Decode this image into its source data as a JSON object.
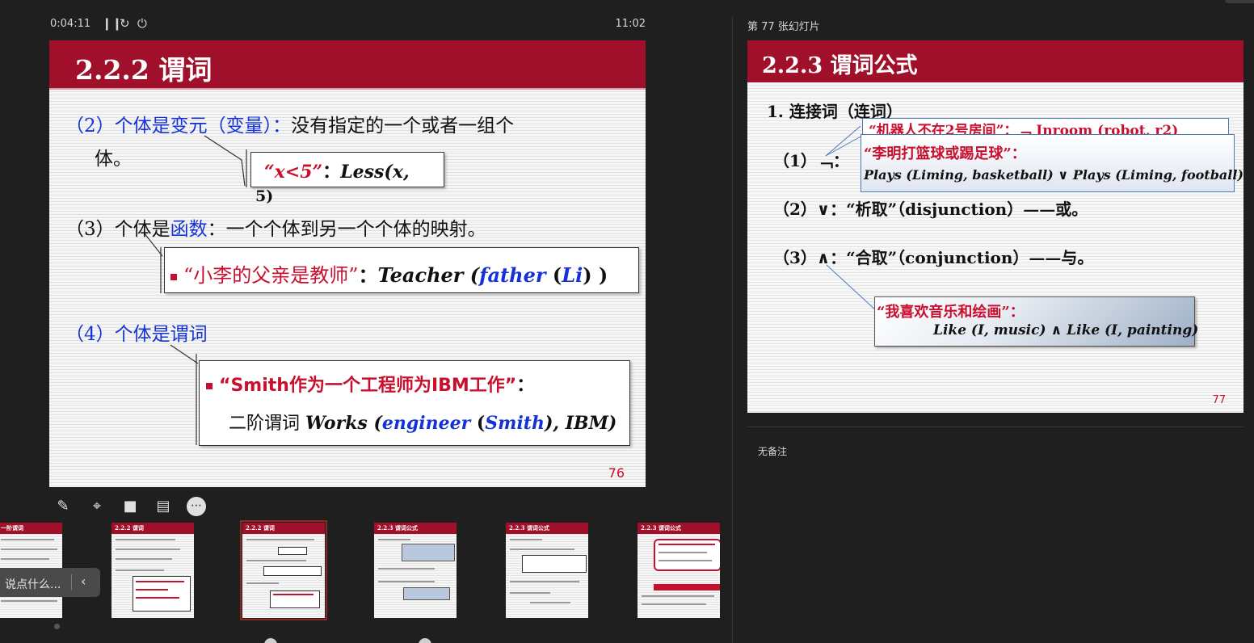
{
  "presenter": {
    "timer": "0:04:11",
    "clock": "11:02",
    "next_slide_label": "第 77 张幻灯片",
    "notes": "无备注",
    "comment_placeholder": "说点什么..."
  },
  "current_slide": {
    "number": "76",
    "title": "2.2.2 谓词",
    "item2_prefix": "（2）个体是变元（变量）：",
    "item2_text": "没有指定的一个或者一组个",
    "item2_text_cont": "体。",
    "box1_quote": "“x<5”",
    "box1_colon": "：",
    "box1_formula": "Less(x,",
    "box1_formula_cont": "5)",
    "item3_prefix": "（3）个体是",
    "item3_keyword": "函数",
    "item3_text": "：一个个体到另一个个体的映射。",
    "box2_quote": "“小李的父亲是教师”",
    "box2_colon": "：",
    "box2_formula_a": "Teacher (",
    "box2_formula_b": "father",
    "box2_formula_c": " (",
    "box2_formula_d": "Li",
    "box2_formula_e": ") )",
    "item4_prefix": "（4）个体是",
    "item4_keyword": "谓词",
    "box3_quote": "“Smith作为一个工程师为IBM工作”",
    "box3_colon": "：",
    "box3_line2_label": "二阶谓词",
    "box3_formula_a": "Works (",
    "box3_formula_b": "engineer",
    "box3_formula_c": " (",
    "box3_formula_d": "Smith",
    "box3_formula_e": "), IBM)"
  },
  "next_slide": {
    "number": "77",
    "title": "2.2.3 谓词公式",
    "heading": "1. 连接词（连词）",
    "callout1": "“机器人不在2号房间”：﹁ Inroom (robot, r2)",
    "row1_label": "（1）﹁：",
    "callout2_quote": "“李明打篮球或踢足球”：",
    "callout2_formula": "Plays (Liming, basketball) ∨ Plays (Liming, football)",
    "row2_label": "（2）∨：",
    "row2_text": "“析取”（disjunction）——或。",
    "row3_label": "（3）∧：",
    "row3_text": "“合取”（conjunction）——与。",
    "callout3_quote": "“我喜欢音乐和绘画”：",
    "callout3_formula": "Like (I, music) ∧ Like (I, painting)"
  },
  "tools": [
    {
      "name": "pen-icon",
      "glyph": "✎"
    },
    {
      "name": "zoom-icon",
      "glyph": "⌖"
    },
    {
      "name": "camera-icon",
      "glyph": "■"
    },
    {
      "name": "subtitle-icon",
      "glyph": "▤"
    },
    {
      "name": "more-icon",
      "glyph": "⋯"
    }
  ],
  "thumbnails": [
    {
      "title": "一阶谓词"
    },
    {
      "title": "2.2.2 谓词"
    },
    {
      "title": "2.2.2 谓词"
    },
    {
      "title": "2.2.3 谓词公式"
    },
    {
      "title": "2.2.3 谓词公式"
    },
    {
      "title": "2.2.3 谓词公式"
    }
  ]
}
